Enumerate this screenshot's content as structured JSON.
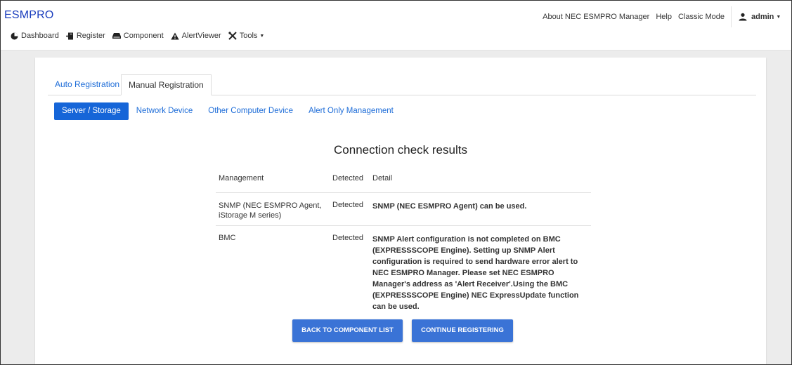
{
  "app": {
    "brand": "ESMPRO"
  },
  "header": {
    "links": [
      "About NEC ESMPRO Manager",
      "Help",
      "Classic Mode"
    ],
    "user": "admin"
  },
  "nav": {
    "items": [
      {
        "label": "Dashboard",
        "icon": "dashboard-icon"
      },
      {
        "label": "Register",
        "icon": "register-icon"
      },
      {
        "label": "Component",
        "icon": "component-icon"
      },
      {
        "label": "AlertViewer",
        "icon": "alert-icon"
      },
      {
        "label": "Tools",
        "icon": "tools-icon"
      }
    ]
  },
  "tabs": {
    "auto": "Auto Registration",
    "manual": "Manual Registration"
  },
  "subnav": [
    "Server / Storage",
    "Network Device",
    "Other Computer Device",
    "Alert Only Management"
  ],
  "results": {
    "title": "Connection check results",
    "headers": [
      "Management",
      "Detected",
      "Detail"
    ],
    "rows": [
      {
        "management": "SNMP (NEC ESMPRO Agent, iStorage M series)",
        "detected": "Detected",
        "detail": "SNMP (NEC ESMPRO Agent) can be used."
      },
      {
        "management": "BMC",
        "detected": "Detected",
        "detail": "SNMP Alert configuration is not completed on BMC (EXPRESSSCOPE Engine). Setting up SNMP Alert configuration is required to send hardware error alert to NEC ESMPRO Manager. Please set NEC ESMPRO Manager's address as 'Alert Receiver'.Using the BMC (EXPRESSSCOPE Engine) NEC ExpressUpdate function can be used."
      }
    ]
  },
  "buttons": {
    "back": "BACK TO COMPONENT LIST",
    "continue": "CONTINUE REGISTERING"
  },
  "colors": {
    "brand": "#1a3dbd",
    "accent": "#1565d8",
    "button": "#3a73d6"
  }
}
